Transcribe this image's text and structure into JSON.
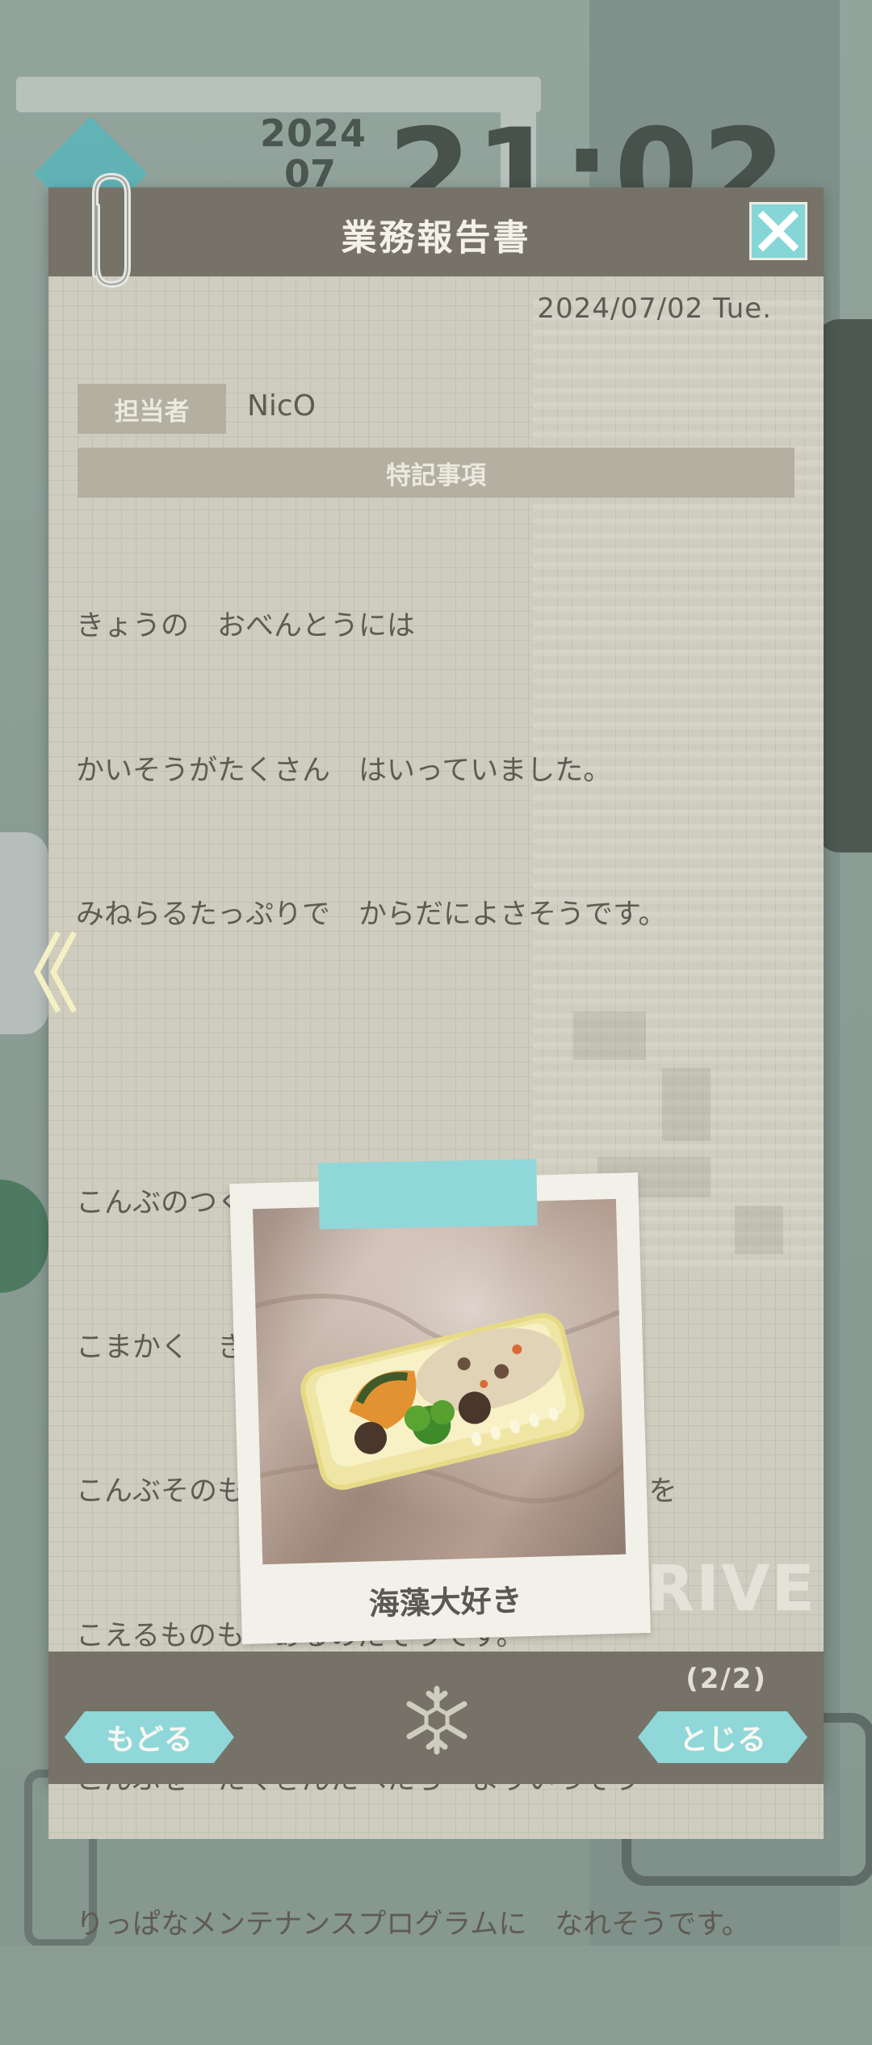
{
  "background": {
    "clock_year": "2024",
    "clock_month": "07",
    "clock_time": "21:02",
    "watermark": "RIVE"
  },
  "report": {
    "title": "業務報告書",
    "date": "2024/07/02 Tue.",
    "assignee_label": "担当者",
    "assignee_name": "NicO",
    "notes_label": "特記事項",
    "body_lines": [
      "きょうの　おべんとうには",
      "かいそうがたくさん　はいっていました。",
      "みねらるたっぷりで　からだによさそうです。",
      "",
      "こんぶのつくだには　ちょうりのかていで",
      "こまかく　きざまれていますが",
      "こんぶそのものの　おおきさは　10めーとるを",
      "こえるものも　あるのだそうです。",
      "こんぶを　たくさんたべたら　よりいっそう",
      "りっぱなメンテナンスプログラムに　なれそうです。"
    ],
    "photo_caption": "海藻大好き"
  },
  "footer": {
    "page_indicator": "(2/2)",
    "back_label": "もどる",
    "close_label": "とじる"
  },
  "icons": {
    "close": "close-x-icon",
    "clip": "paperclip-icon",
    "emblem": "snowflake-icon",
    "prev": "double-chevron-left-icon"
  },
  "colors": {
    "accent": "#8fd7d8",
    "header": "#767268",
    "paper": "#cfcdbf",
    "text": "#5e5b53"
  }
}
